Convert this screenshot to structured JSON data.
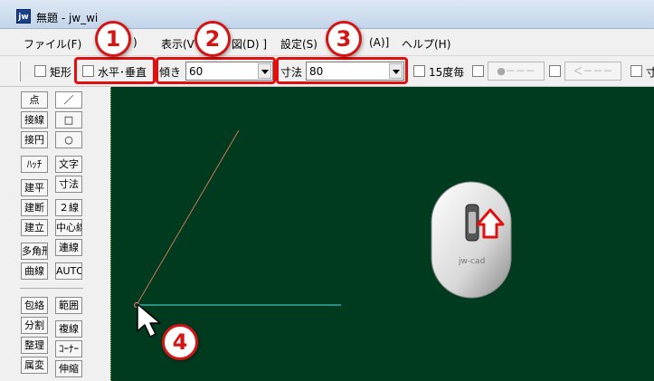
{
  "window": {
    "title": "無題 - jw_wi",
    "app_icon_text": "jw"
  },
  "menu": {
    "items": [
      "ファイル(F)",
      ")",
      "表示(V",
      "図(D) ]",
      "設定(S)",
      "(A)]",
      "ヘルプ(H)"
    ]
  },
  "toolbar": {
    "rect_label": "矩形",
    "hv_label": "水平･垂直",
    "angle_label": "傾き",
    "angle_value": "60",
    "dim_label": "寸法",
    "dim_value": "80",
    "deg15_label": "15度毎",
    "btn1": "●－－－",
    "btn2": "＜－－－",
    "tail_label": "寸"
  },
  "annotations": {
    "b1": "1",
    "b2": "2",
    "b3": "3",
    "b4": "4"
  },
  "tools": {
    "col1": [
      "点",
      "接線",
      "接円",
      "ﾊｯﾁ",
      "建平",
      "建断",
      "建立",
      "多角形",
      "曲線",
      "包絡",
      "分割",
      "整理",
      "属変"
    ],
    "col2": [
      "／",
      "□",
      "○",
      "文字",
      "寸法",
      "２線",
      "中心線",
      "連線",
      "AUTO",
      "範囲",
      "複線",
      "ｺｰﾅｰ",
      "伸縮"
    ]
  },
  "mouse": {
    "brand": "jw-cad"
  },
  "colors": {
    "canvas": "#003b20",
    "highlight": "#e01010",
    "red_line": "#c87850",
    "cyan_line": "#40c0c0"
  }
}
